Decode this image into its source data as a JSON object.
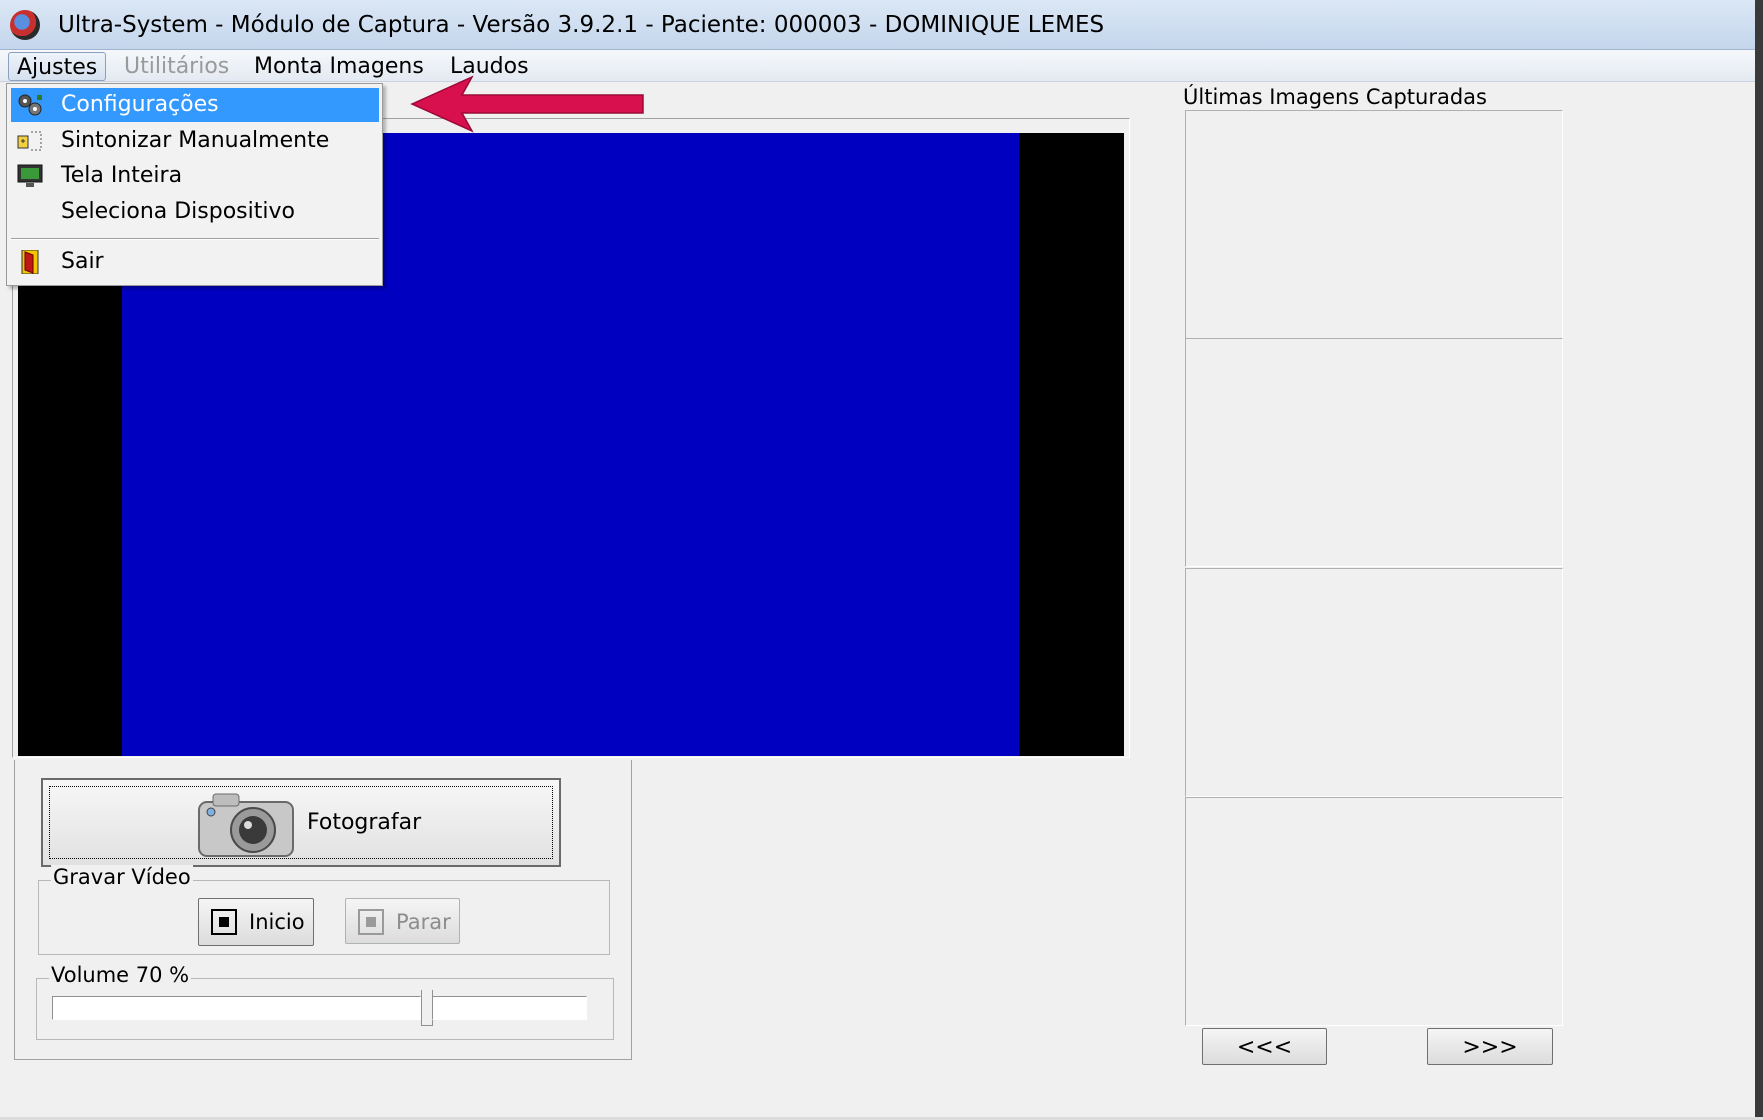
{
  "window": {
    "title": "Ultra-System - Módulo de Captura - Versão 3.9.2.1 -  Paciente: 000003 - DOMINIQUE LEMES"
  },
  "menubar": {
    "items": [
      {
        "label": "Ajustes",
        "state": "open"
      },
      {
        "label": "Utilitários",
        "state": "disabled"
      },
      {
        "label": "Monta Imagens"
      },
      {
        "label": "Laudos"
      }
    ]
  },
  "dropdown": {
    "items": [
      {
        "label": "Configurações",
        "icon": "gears-icon",
        "highlighted": true
      },
      {
        "label": "Sintonizar Manualmente",
        "icon": "tune-icon"
      },
      {
        "label": "Tela Inteira",
        "icon": "monitor-icon"
      },
      {
        "label": "Seleciona Dispositivo",
        "icon": ""
      },
      {
        "label": "Sair",
        "icon": "exit-door-icon"
      }
    ]
  },
  "annotation": {
    "arrow_color": "#d8104e"
  },
  "video": {
    "preview_color": "#0000c0"
  },
  "capture": {
    "fotografar_label": "Fotografar",
    "video_group_label": "Gravar Vídeo",
    "inicio_label": "Inicio",
    "parar_label": "Parar",
    "volume_label": "Volume 70 %",
    "volume_percent": 70
  },
  "gallery": {
    "title": "Últimas Imagens Capturadas",
    "prev_label": "<<<",
    "next_label": ">>>"
  },
  "colors": {
    "highlight": "#3399ff",
    "background": "#f0f0f0"
  }
}
